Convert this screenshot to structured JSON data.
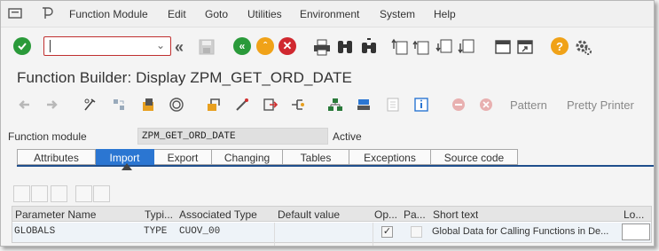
{
  "menu": {
    "items": [
      "Function Module",
      "Edit",
      "Goto",
      "Utilities",
      "Environment",
      "System",
      "Help"
    ]
  },
  "command_field": {
    "value": ""
  },
  "title": "Function Builder: Display ZPM_GET_ORD_DATE",
  "app_toolbar": {
    "pattern": "Pattern",
    "pretty_printer": "Pretty Printer"
  },
  "function_module": {
    "label": "Function module",
    "value": "ZPM_GET_ORD_DATE",
    "status": "Active"
  },
  "tabs": [
    {
      "label": "Attributes",
      "active": false
    },
    {
      "label": "Import",
      "active": true
    },
    {
      "label": "Export",
      "active": false
    },
    {
      "label": "Changing",
      "active": false
    },
    {
      "label": "Tables",
      "active": false
    },
    {
      "label": "Exceptions",
      "active": false
    },
    {
      "label": "Source code",
      "active": false
    }
  ],
  "table": {
    "columns": [
      "Parameter Name",
      "Typi...",
      "Associated Type",
      "Default value",
      "Op...",
      "Pa...",
      "Short text",
      "Lo..."
    ],
    "rows": [
      {
        "parameter": "GLOBALS",
        "typing": "TYPE",
        "assoc_type": "CUOV_00",
        "default": "",
        "optional": true,
        "pass_value": false,
        "short_text": "Global Data for Calling Functions in De..."
      }
    ]
  },
  "colors": {
    "active_tab": "#2b76d2",
    "ok_green": "#2a9a3a",
    "cancel_red": "#d0282f",
    "exit_orange": "#f0a218",
    "help_orange": "#f0a218"
  }
}
